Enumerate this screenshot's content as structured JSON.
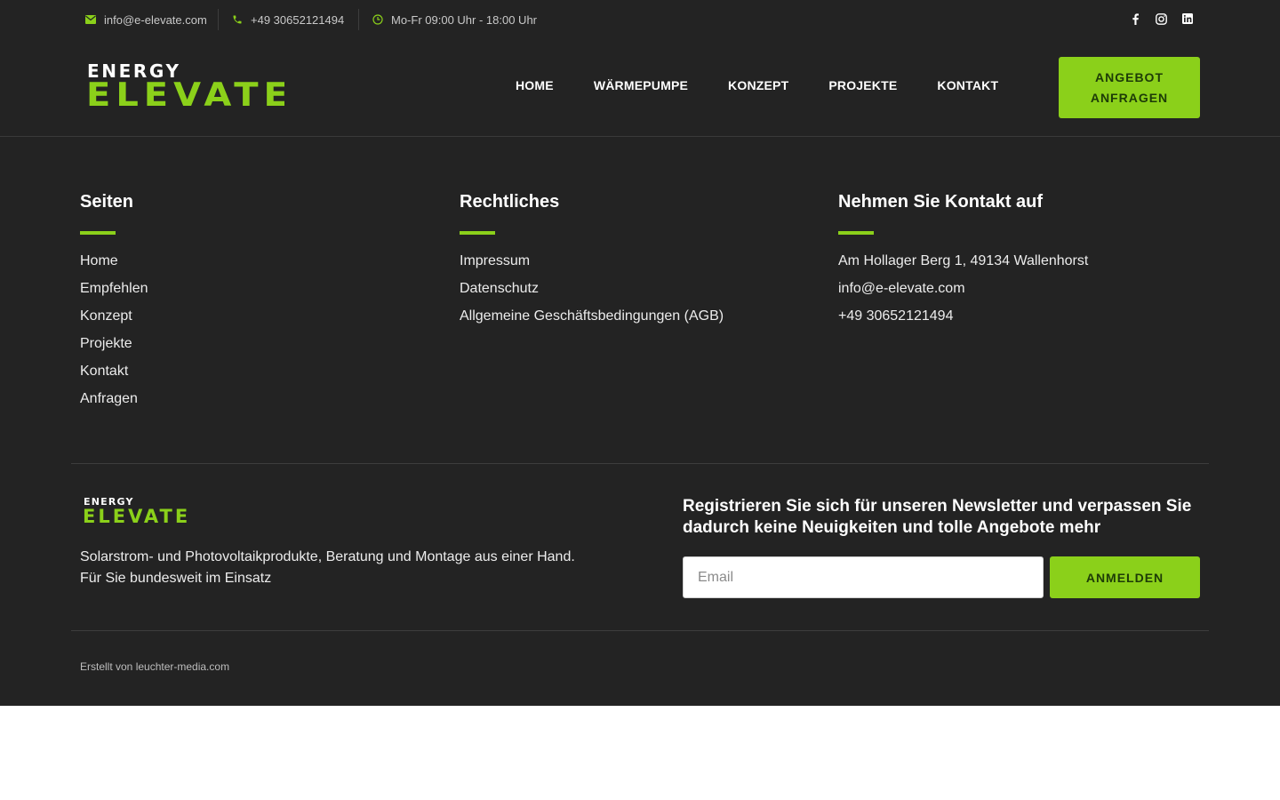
{
  "topbar": {
    "email": "info@e-elevate.com",
    "phone": "+49 30652121494",
    "hours": "Mo-Fr 09:00 Uhr - 18:00 Uhr",
    "socials": [
      "facebook-icon",
      "instagram-icon",
      "linkedin-icon"
    ]
  },
  "logo": {
    "top_word": "ENERGY",
    "bottom_word": "ELEVATE"
  },
  "nav": {
    "items": [
      "HOME",
      "WÄRMEPUMPE",
      "KONZEPT",
      "PROJEKTE",
      "KONTAKT"
    ],
    "cta_line1": "ANGEBOT",
    "cta_line2": "ANFRAGEN"
  },
  "footer": {
    "pages": {
      "title": "Seiten",
      "links": [
        "Home",
        "Empfehlen",
        "Konzept",
        "Projekte",
        "Kontakt",
        "Anfragen"
      ]
    },
    "legal": {
      "title": "Rechtliches",
      "links": [
        "Impressum",
        "Datenschutz",
        "Allgemeine Geschäftsbedingungen (AGB)"
      ]
    },
    "contact": {
      "title": "Nehmen Sie Kontakt auf",
      "lines": [
        "Am Hollager Berg 1, 49134 Wallenhorst",
        "info@e-elevate.com",
        "+49 30652121494"
      ]
    },
    "tagline": "Solarstrom- und Photovoltaikprodukte, Beratung und Montage aus einer Hand. Für Sie bundesweit im Einsatz",
    "newsletter": {
      "title": "Registrieren Sie sich für unseren Newsletter und verpassen Sie dadurch keine Neuigkeiten und tolle Angebote mehr",
      "placeholder": "Email",
      "button": "ANMELDEN"
    },
    "credit": "Erstellt von leuchter-media.com"
  },
  "colors": {
    "accent": "#8bd01a",
    "background": "#232323",
    "page_below": "#ffffff"
  }
}
